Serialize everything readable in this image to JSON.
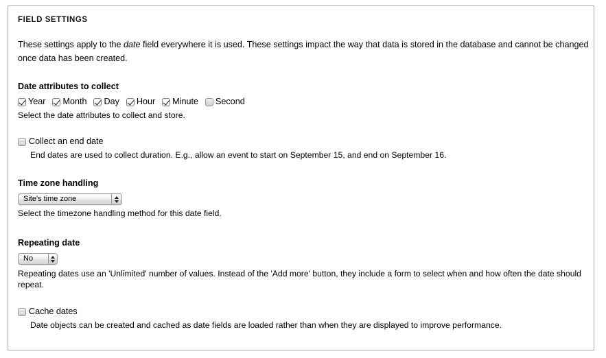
{
  "fieldset": {
    "legend": "FIELD SETTINGS",
    "intro_before": "These settings apply to the ",
    "intro_italic": "date",
    "intro_after": " field everywhere it is used. These settings impact the way that data is stored in the database and cannot be changed once data has been created."
  },
  "date_attributes": {
    "label": "Date attributes to collect",
    "description": "Select the date attributes to collect and store.",
    "options": [
      {
        "label": "Year",
        "checked": true
      },
      {
        "label": "Month",
        "checked": true
      },
      {
        "label": "Day",
        "checked": true
      },
      {
        "label": "Hour",
        "checked": true
      },
      {
        "label": "Minute",
        "checked": true
      },
      {
        "label": "Second",
        "checked": false
      }
    ]
  },
  "end_date": {
    "label": "Collect an end date",
    "checked": false,
    "description": "End dates are used to collect duration. E.g., allow an event to start on September 15, and end on September 16."
  },
  "time_zone": {
    "label": "Time zone handling",
    "selected": "Site's time zone",
    "description": "Select the timezone handling method for this date field."
  },
  "repeating_date": {
    "label": "Repeating date",
    "selected": "No",
    "description": "Repeating dates use an 'Unlimited' number of values. Instead of the 'Add more' button, they include a form to select when and how often the date should repeat."
  },
  "cache_dates": {
    "label": "Cache dates",
    "checked": false,
    "description": "Date objects can be created and cached as date fields are loaded rather than when they are displayed to improve performance."
  },
  "colors": {
    "border": "#a9a9a9",
    "text": "#000000",
    "background": "#ffffff"
  }
}
